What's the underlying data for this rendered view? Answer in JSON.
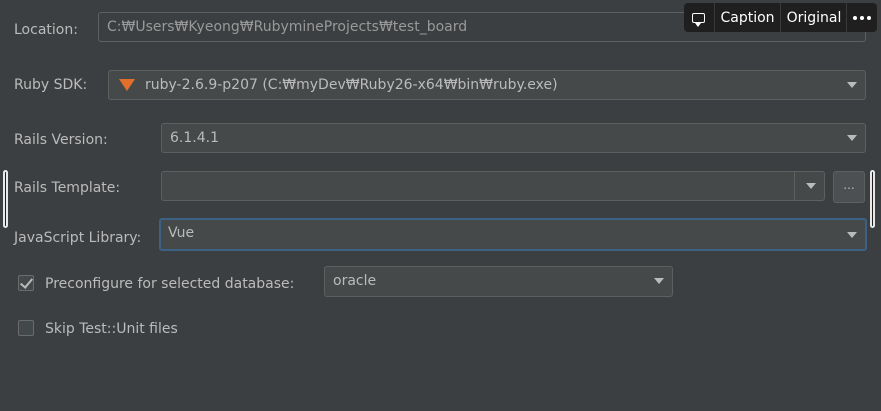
{
  "location": {
    "label": "Location:",
    "value": "C:₩Users₩Kyeong₩RubymineProjects₩test_board"
  },
  "ruby_sdk": {
    "label": "Ruby SDK:",
    "value": "ruby-2.6.9-p207 (C:₩myDev₩Ruby26-x64₩bin₩ruby.exe)",
    "icon": "ruby-icon"
  },
  "rails_version": {
    "label": "Rails Version:",
    "value": "6.1.4.1"
  },
  "rails_template": {
    "label": "Rails Template:",
    "value": "",
    "browse_label": "..."
  },
  "js_library": {
    "label": "JavaScript Library:",
    "value": "Vue"
  },
  "preconfigure": {
    "label": "Preconfigure for selected database:",
    "checked": true,
    "value": "oracle"
  },
  "skip_test": {
    "label": "Skip Test::Unit files",
    "checked": false
  },
  "overlay": {
    "caption": "Caption",
    "original": "Original"
  },
  "colors": {
    "background": "#3c3f41",
    "focus_border": "#3d6185",
    "ruby_icon": "#e26f2b"
  }
}
